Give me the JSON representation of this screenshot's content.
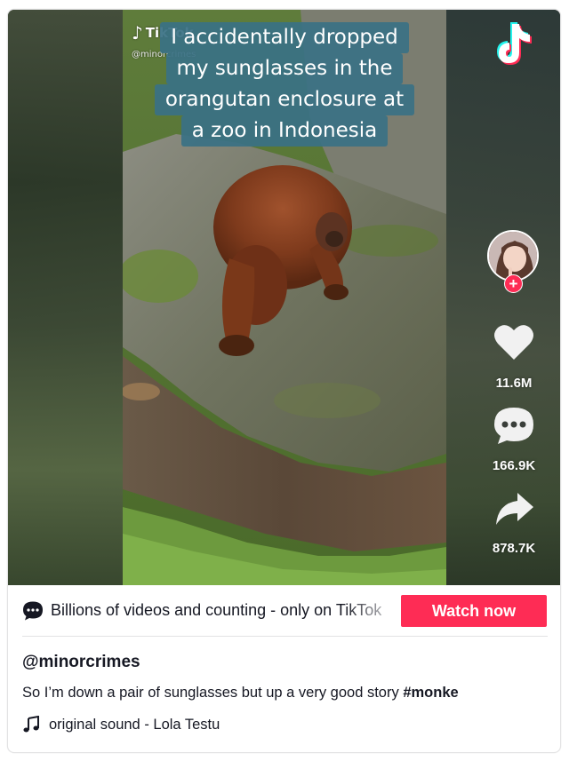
{
  "video": {
    "watermark_brand": "TikTok",
    "watermark_handle": "@minorcrimes",
    "caption_lines": [
      "I accidentally dropped",
      "my sunglasses in the",
      "orangutan enclosure at",
      "a zoo in Indonesia"
    ]
  },
  "side_bar": {
    "follow_symbol": "+",
    "likes": "11.6M",
    "comments": "166.9K",
    "shares": "878.7K",
    "icons": [
      "tiktok-logo-icon",
      "heart-icon",
      "comment-icon",
      "share-icon"
    ]
  },
  "promo": {
    "text": "Billions of videos and counting - only on TikTok",
    "button_label": "Watch now",
    "icon": "chat-bubble-icon"
  },
  "post": {
    "author": "@minorcrimes",
    "description": "So I’m down a pair of sunglasses but up a very good story ",
    "hashtag": "#monke",
    "music_icon": "music-note-icon",
    "music": "original sound - Lola Testu"
  },
  "colors": {
    "accent": "#fe2c55",
    "caption_bg": "#3a7184",
    "text": "#161823",
    "tiktok_cyan": "#25f4ee"
  }
}
